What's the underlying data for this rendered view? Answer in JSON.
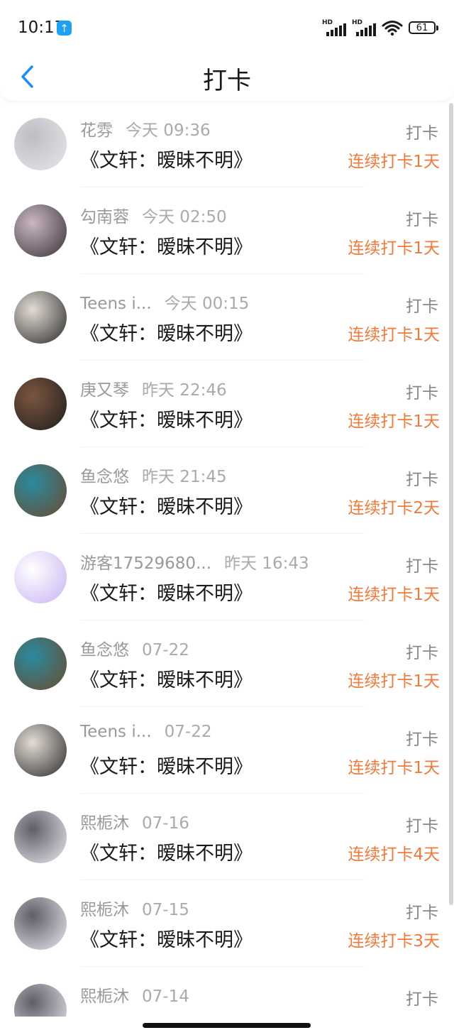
{
  "status_bar": {
    "time": "10:17",
    "battery": "61",
    "signal_label": "HD"
  },
  "header": {
    "title": "打卡"
  },
  "rows": [
    {
      "name": "花雰",
      "time": "今天 09:36",
      "book": "《文轩：暧昧不明》",
      "action": "打卡",
      "streak": "连续打卡1天",
      "avatar_colors": [
        "#e7e7ea",
        "#bdbdc4"
      ]
    },
    {
      "name": "勾南蓉",
      "time": "今天 02:50",
      "book": "《文轩：暧昧不明》",
      "action": "打卡",
      "streak": "连续打卡1天",
      "avatar_colors": [
        "#3a3138",
        "#c9b7c2"
      ]
    },
    {
      "name": "Teens i...",
      "time": "今天 00:15",
      "book": "《文轩：暧昧不明》",
      "action": "打卡",
      "streak": "连续打卡1天",
      "avatar_colors": [
        "#2b2b2b",
        "#e3dcd4"
      ]
    },
    {
      "name": "庚又琴",
      "time": "昨天 22:46",
      "book": "《文轩：暧昧不明》",
      "action": "打卡",
      "streak": "连续打卡1天",
      "avatar_colors": [
        "#1d1d1d",
        "#7b5640"
      ]
    },
    {
      "name": "鱼念悠",
      "time": "昨天 21:45",
      "book": "《文轩：暧昧不明》",
      "action": "打卡",
      "streak": "连续打卡2天",
      "avatar_colors": [
        "#6b4b2d",
        "#2a8aa0"
      ]
    },
    {
      "name": "游客17529680...",
      "time": "昨天 16:43",
      "book": "《文轩：暧昧不明》",
      "action": "打卡",
      "streak": "连续打卡1天",
      "avatar_colors": [
        "#c9b2f2",
        "#ffffff"
      ]
    },
    {
      "name": "鱼念悠",
      "time": "07-22",
      "book": "《文轩：暧昧不明》",
      "action": "打卡",
      "streak": "连续打卡1天",
      "avatar_colors": [
        "#6b4b2d",
        "#2a8aa0"
      ]
    },
    {
      "name": "Teens i...",
      "time": "07-22",
      "book": "《文轩：暧昧不明》",
      "action": "打卡",
      "streak": "连续打卡1天",
      "avatar_colors": [
        "#2b2b2b",
        "#e3dcd4"
      ]
    },
    {
      "name": "熙栀沐",
      "time": "07-16",
      "book": "《文轩：暧昧不明》",
      "action": "打卡",
      "streak": "连续打卡4天",
      "avatar_colors": [
        "#e9e9ee",
        "#5e5e69"
      ]
    },
    {
      "name": "熙栀沐",
      "time": "07-15",
      "book": "《文轩：暧昧不明》",
      "action": "打卡",
      "streak": "连续打卡3天",
      "avatar_colors": [
        "#e9e9ee",
        "#5e5e69"
      ]
    },
    {
      "name": "熙栀沐",
      "time": "07-14",
      "book": "",
      "action": "打卡",
      "streak": "",
      "avatar_colors": [
        "#e9e9ee",
        "#5e5e69"
      ]
    }
  ],
  "colors": {
    "accent": "#1e8ff0",
    "streak": "#f07a3a"
  }
}
